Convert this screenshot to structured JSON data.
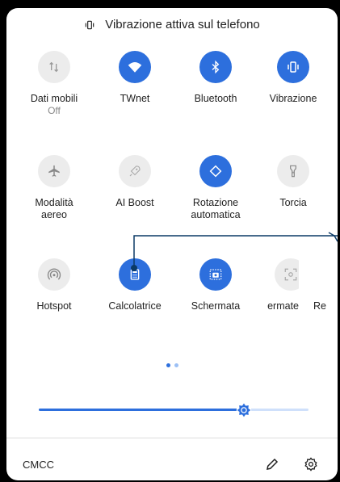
{
  "header": {
    "text": "Vibrazione attiva sul telefono"
  },
  "tiles": [
    {
      "label": "Dati mobili",
      "sub": "Off"
    },
    {
      "label": "TWnet",
      "sub": ""
    },
    {
      "label": "Bluetooth",
      "sub": ""
    },
    {
      "label": "Vibrazione",
      "sub": ""
    },
    {
      "label": "Modalità aereo",
      "sub": ""
    },
    {
      "label": "AI Boost",
      "sub": ""
    },
    {
      "label": "Rotazione automatica",
      "sub": ""
    },
    {
      "label": "Torcia",
      "sub": ""
    },
    {
      "label": "Hotspot",
      "sub": ""
    },
    {
      "label": "Calcolatrice",
      "sub": ""
    },
    {
      "label": "Schermata",
      "sub": ""
    },
    {
      "label": "ermate",
      "sub": ""
    },
    {
      "label": "Re",
      "sub": ""
    }
  ],
  "brightness": {
    "level": 0.76
  },
  "footer": {
    "carrier": "CMCC"
  },
  "colors": {
    "accent": "#2d6fdd",
    "off": "#ececec",
    "icon_off": "#888888"
  },
  "icons": [
    "vibrate-icon",
    "mobile-data-icon",
    "wifi-icon",
    "bluetooth-icon",
    "vibrate-icon",
    "airplane-icon",
    "rocket-icon",
    "rotate-icon",
    "flashlight-icon",
    "hotspot-icon",
    "calculator-icon",
    "screenshot-icon",
    "screen-capture-icon",
    "brightness-icon",
    "edit-icon",
    "settings-icon"
  ]
}
